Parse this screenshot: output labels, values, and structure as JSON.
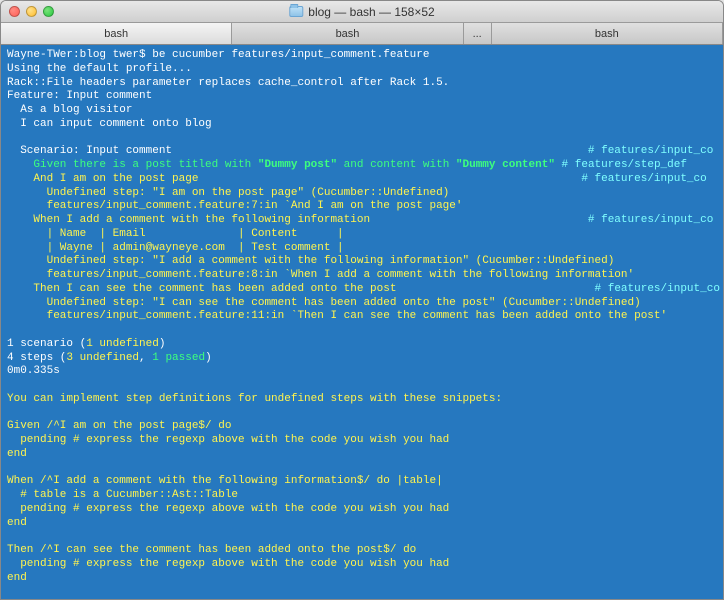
{
  "window": {
    "title": "blog — bash — 158×52"
  },
  "tabs": {
    "items": [
      {
        "label": "bash"
      },
      {
        "label": "bash"
      },
      {
        "label": "..."
      },
      {
        "label": "bash"
      }
    ]
  },
  "term": {
    "prompt": "Wayne-TWer:blog twer$ ",
    "cmd": "be cucumber features/input_comment.feature",
    "l2": "Using the default profile...",
    "l3": "Rack::File headers parameter replaces cache_control after Rack 1.5.",
    "l4": "Feature: Input comment",
    "l5": "  As a blog visitor",
    "l6": "  I can input comment onto blog",
    "scenario_pre": "  Scenario: Input comment",
    "scenario_tag": "# features/input_co",
    "g1a": "    Given ",
    "g1b": "there is a post titled with ",
    "g1q1": "\"Dummy post\"",
    "g1c": " and content with ",
    "g1q2": "\"Dummy content\"",
    "g1tag": " # features/step_def",
    "a1": "    And I am on the post page",
    "a1tag": "# features/input_co",
    "u1": "      Undefined step: \"I am on the post page\" (Cucumber::Undefined)",
    "u1b": "      features/input_comment.feature:7:in `And I am on the post page'",
    "w1": "    When I add a comment with the following information",
    "w1tag": "# features/input_co",
    "tblh": "      | Name  | Email              | Content      |",
    "tblr": "      | Wayne | admin@wayneye.com  | Test comment |",
    "u2": "      Undefined step: \"I add a comment with the following information\" (Cucumber::Undefined)",
    "u2b": "      features/input_comment.feature:8:in `When I add a comment with the following information'",
    "t1": "    Then I can see the comment has been added onto the post",
    "t1tag": "# features/input_co",
    "u3": "      Undefined step: \"I can see the comment has been added onto the post\" (Cucumber::Undefined)",
    "u3b": "      features/input_comment.feature:11:in `Then I can see the comment has been added onto the post'",
    "s1a": "1 scenario (",
    "s1b": "1 undefined",
    "s1c": ")",
    "s2a": "4 steps (",
    "s2b": "3 undefined",
    "s2c": ", ",
    "s2d": "1 passed",
    "s2e": ")",
    "time": "0m0.335s",
    "snip_intro": "You can implement step definitions for undefined steps with these snippets:",
    "sn1a": "Given /^I am on the post page$/ do",
    "sn1b": "  pending # express the regexp above with the code you wish you had",
    "sn1c": "end",
    "sn2a": "When /^I add a comment with the following information$/ do |table|",
    "sn2b": "  # table is a Cucumber::Ast::Table",
    "sn2c": "  pending # express the regexp above with the code you wish you had",
    "sn2d": "end",
    "sn3a": "Then /^I can see the comment has been added onto the post$/ do",
    "sn3b": "  pending # express the regexp above with the code you wish you had",
    "sn3c": "end"
  }
}
